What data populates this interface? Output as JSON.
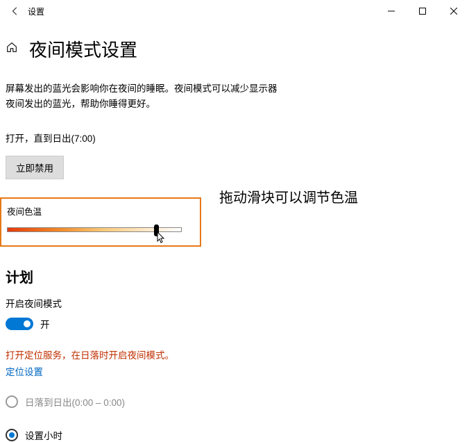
{
  "window": {
    "title": "设置"
  },
  "page": {
    "title": "夜间模式设置",
    "description_line1": "屏幕发出的蓝光会影响你在夜间的睡眠。夜间模式可以减少显示器",
    "description_line2": "夜间发出的蓝光，帮助你睡得更好。",
    "schedule_text": "打开，直到日出(7:00)",
    "disable_now": "立即禁用"
  },
  "color_temp": {
    "label": "夜间色温",
    "annotation": "拖动滑块可以调节色温"
  },
  "schedule": {
    "heading": "计划",
    "toggle_label": "开启夜间模式",
    "toggle_state": "开",
    "location_warning": "打开定位服务，在日落时开启夜间模式。",
    "location_link": "定位设置",
    "option_sunset": "日落到日出(0:00 – 0:00)",
    "option_hours": "设置小时"
  }
}
